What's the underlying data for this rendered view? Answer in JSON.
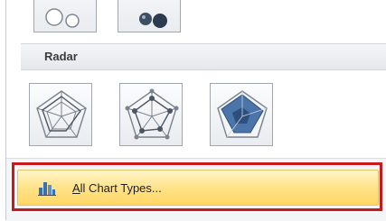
{
  "gallery": {
    "section_title": "Radar",
    "top_row_icons": [
      "bubble-chart-icon",
      "3d-bubble-chart-icon"
    ],
    "radar_icons": [
      "radar-chart-icon",
      "radar-with-markers-icon",
      "filled-radar-icon"
    ]
  },
  "menu": {
    "all_chart_types_mnemonic": "A",
    "all_chart_types_rest": "ll Chart Types...",
    "icon": "column-chart-icon"
  },
  "colors": {
    "highlight_border": "#c8191f",
    "hover_fill": "#ffe184",
    "radar_fill": "#4b74a8"
  }
}
